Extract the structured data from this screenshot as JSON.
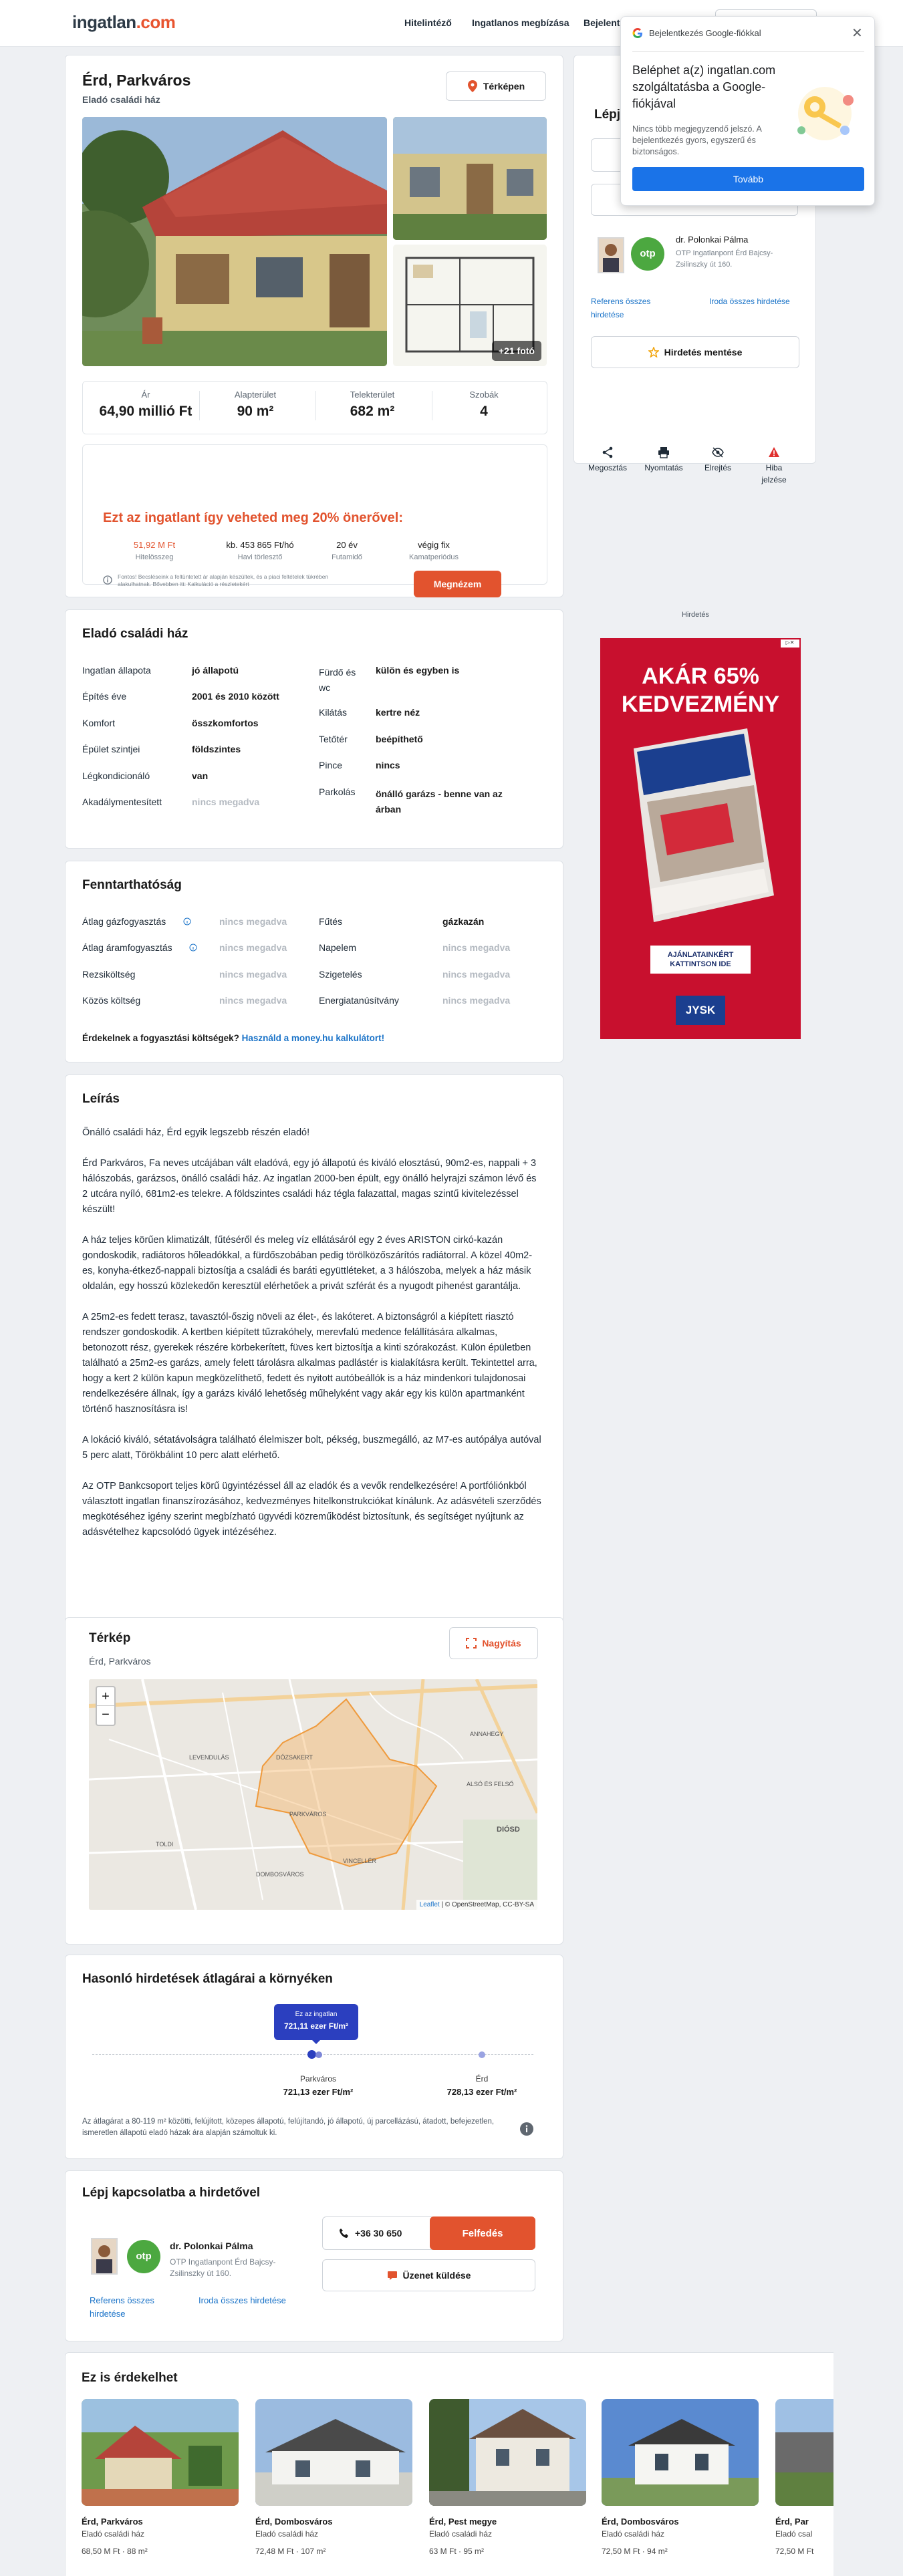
{
  "header": {
    "logo_part1": "ingatlan",
    "logo_part2": ".com",
    "nav": [
      "Hitelintéző",
      "Ingatlanos megbízása",
      "Bejelentk"
    ]
  },
  "google_popup": {
    "top_label": "Bejelentkezés Google-fiókkal",
    "title": "Beléphet a(z) ingatlan.com szolgáltatásba a Google-fiókjával",
    "body": "Nincs több megjegyzendő jelszó. A bejelentkezés gyors, egyszerű és biztonságos.",
    "button": "Tovább"
  },
  "listing": {
    "title": "Érd, Parkváros",
    "subtitle": "Eladó családi ház",
    "map_button": "Térképen",
    "photo_count": "+21 fotó",
    "stats": [
      {
        "label": "Ár",
        "value": "64,90 millió Ft"
      },
      {
        "label": "Alapterület",
        "value": "90 m²"
      },
      {
        "label": "Telekterület",
        "value": "682 m²"
      },
      {
        "label": "Szobák",
        "value": "4"
      }
    ],
    "finance_title": "Ezt az ingatlant így veheted meg 20% önerővel:",
    "finance": [
      {
        "value": "51,92 M Ft",
        "label": "Hitelösszeg"
      },
      {
        "value": "kb. 453 865 Ft/hó",
        "label": "Havi törlesztő"
      },
      {
        "value": "20 év",
        "label": "Futamidő"
      },
      {
        "value": "végig fix",
        "label": "Kamatperiódus"
      }
    ],
    "finance_note": "Fontos! Becsléseink a feltüntetett ár alapján készültek, és a piaci feltételek tükrében alakulhatnak. Bővebben itt: Kalkuláció a részletekért",
    "finance_button": "Megnézem"
  },
  "params": {
    "title": "Eladó családi ház",
    "left": [
      {
        "k": "Ingatlan állapota",
        "v": "jó állapotú"
      },
      {
        "k": "Építés éve",
        "v": "2001 és 2010 között"
      },
      {
        "k": "Komfort",
        "v": "összkomfortos"
      },
      {
        "k": "Épület szintjei",
        "v": "földszintes"
      },
      {
        "k": "Légkondicionáló",
        "v": "van"
      },
      {
        "k": "Akadálymentesített",
        "v": "nincs megadva"
      }
    ],
    "right": [
      {
        "k": "Fürdő és wc",
        "v": "külön és egyben is"
      },
      {
        "k": "Kilátás",
        "v": "kertre néz"
      },
      {
        "k": "Tetőtér",
        "v": "beépíthető"
      },
      {
        "k": "Pince",
        "v": "nincs"
      },
      {
        "k": "Parkolás",
        "v": "önálló garázs - benne van az árban"
      }
    ]
  },
  "sustain": {
    "title": "Fenntarthatóság",
    "left": [
      {
        "k": "Átlag gázfogyasztás",
        "v": "nincs megadva"
      },
      {
        "k": "Átlag áramfogyasztás",
        "v": "nincs megadva"
      },
      {
        "k": "Rezsiköltség",
        "v": "nincs megadva"
      },
      {
        "k": "Közös költség",
        "v": "nincs megadva"
      }
    ],
    "right": [
      {
        "k": "Fűtés",
        "v": "gázkazán"
      },
      {
        "k": "Napelem",
        "v": "nincs megadva"
      },
      {
        "k": "Szigetelés",
        "v": "nincs megadva"
      },
      {
        "k": "Energiatanúsítvány",
        "v": "nincs megadva"
      }
    ],
    "footer_text": "Érdekelnek a fogyasztási költségek?",
    "footer_link": "Használd a money.hu kalkulátort!"
  },
  "description": {
    "title": "Leírás",
    "paragraphs": [
      "Önálló családi ház, Érd egyik legszebb részén eladó!",
      "Érd Parkváros, Fa neves utcájában vált eladóvá, egy jó állapotú és kiváló elosztású, 90m2-es, nappali + 3 hálószobás, garázsos, önálló családi ház. Az ingatlan 2000-ben épült, egy önálló helyrajzi számon lévő és 2 utcára nyíló, 681m2-es telekre. A földszintes családi ház tégla falazattal, magas szintű kivitelezéssel készült!",
      "A ház teljes körűen klimatizált, fűtéséről és meleg víz ellátásáról egy 2 éves ARISTON cirkó-kazán gondoskodik, radiátoros hőleadókkal, a fürdőszobában pedig törölközőszárítós radiátorral. A közel 40m2-es, konyha-étkező-nappali biztosítja a családi és baráti együttléteket, a 3 hálószoba, melyek a ház másik oldalán, egy hosszú közlekedőn keresztül elérhetőek a privát szférát és a nyugodt pihenést garantálja.",
      "A 25m2-es fedett terasz, tavasztól-őszig növeli az élet-, és lakóteret. A biztonságról a kiépített riasztó rendszer gondoskodik. A kertben kiépített tűzrakóhely, merevfalú medence felállítására alkalmas, betonozott rész, gyerekek részére körbekerített, füves kert biztosítja a kinti szórakozást. Külön épületben található a 25m2-es garázs, amely felett tárolásra alkalmas padlástér is kialakításra került. Tekintettel arra, hogy a kert 2 külön kapun megközelíthető, fedett és nyitott autóbeállók is a ház mindenkori tulajdonosai rendelkezésére állnak, így a garázs kiváló lehetőség műhelyként vagy akár egy kis külön apartmanként történő hasznosításra is!",
      "A lokáció kiváló, sétatávolságra található élelmiszer bolt, pékség, buszmegálló, az M7-es autópálya autóval 5 perc alatt, Törökbálint 10 perc alatt elérhető.",
      "Az OTP Bankcsoport teljes körű ügyintézéssel áll az eladók és a vevők rendelkezésére! A portfóliónkból választott ingatlan finanszírozásához, kedvezményes hitelkonstrukciókat kínálunk. Az adásvételi szerződés megkötéséhez igény szerint megbízható ügyvédi közreműködést biztosítunk, és segítséget nyújtunk az adásvételhez kapcsolódó ügyek intézéséhez."
    ]
  },
  "map": {
    "title": "Térkép",
    "subtitle": "Érd, Parkváros",
    "enlarge": "Nagyítás",
    "zoom_in": "+",
    "zoom_out": "−",
    "labels": [
      "PARKVÁROS",
      "DÓZSAKERT",
      "TOLDI",
      "DOMBOSVÁROS",
      "VINCELLÉR",
      "ALSÓ ÉS FELSŐ",
      "DIÓSD",
      "ANNAHEGY",
      "LEVENDULÁS"
    ],
    "attr_leaflet": "Leaflet",
    "attr_rest": " | © OpenStreetMap, CC-BY-SA"
  },
  "prices": {
    "title": "Hasonló hirdetések átlagárai a környéken",
    "bubble_l1": "Ez az ingatlan",
    "bubble_l2": "721,11 ezer Ft/m²",
    "points": [
      {
        "name": "Parkváros",
        "value": "721,13 ezer Ft/m²"
      },
      {
        "name": "Érd",
        "value": "728,13 ezer Ft/m²"
      }
    ],
    "note": "Az átlagárat a 80-119 m² közötti, felújított, közepes állapotú, felújítandó, jó állapotú, új parcellázású, átadott, befejezetlen, ismeretlen állapotú eladó házak ára alapján számoltuk ki."
  },
  "contact": {
    "title": "Lépj kapcsolatba a hirdetővel",
    "agent_name": "dr. Polonkai Pálma",
    "agency": "OTP Ingatlanpont Érd Bajcsy-Zsilinszky út 160.",
    "phone": "+36 30 650",
    "call_btn": "Felfedés",
    "msg_btn": "Üzenet küldése",
    "link1": "Referens összes hirdetése",
    "link2": "Iroda összes hirdetése",
    "otp": "otp"
  },
  "sidebar": {
    "title": "Lépj",
    "agent_name": "dr. Polonkai Pálma",
    "agency": "OTP Ingatlanpont Érd Bajcsy-Zsilinszky út 160.",
    "link1": "Referens összes hirdetése",
    "link2": "Iroda összes hirdetése",
    "save_btn": "Hirdetés mentése",
    "actions": [
      "Megosztás",
      "Nyomtatás",
      "Elrejtés",
      "Hiba jelzése"
    ],
    "ad_label": "Hirdetés"
  },
  "ad": {
    "line1": "AKÁR 65%",
    "line2": "KEDVEZMÉNY",
    "cta": "AJÁNLATAINKÉRT KATTINTSON IDE",
    "brand": "JYSK"
  },
  "similar": {
    "title": "Ez is érdekelhet",
    "items": [
      {
        "title": "Érd, Parkváros",
        "sub": "Eladó családi ház",
        "price": "68,50 M Ft",
        "area": "88 m²"
      },
      {
        "title": "Érd, Dombosváros",
        "sub": "Eladó családi ház",
        "price": "72,48 M Ft",
        "area": "107 m²"
      },
      {
        "title": "Érd, Pest megye",
        "sub": "Eladó családi ház",
        "price": "63 M Ft",
        "area": "95 m²"
      },
      {
        "title": "Érd, Dombosváros",
        "sub": "Eladó családi ház",
        "price": "72,50 M Ft",
        "area": "94 m²"
      },
      {
        "title": "Érd, Par",
        "sub": "Eladó csal",
        "price": "72,50 M Ft",
        "area": ""
      }
    ]
  }
}
